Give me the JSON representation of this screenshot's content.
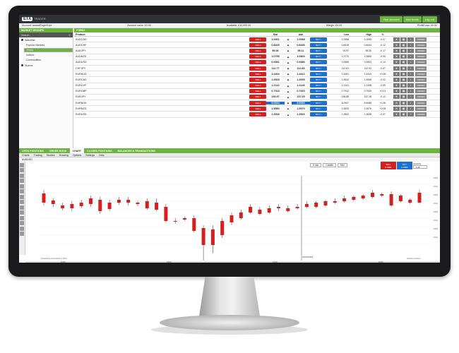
{
  "header": {
    "logo_text": "ETX",
    "logo_sub": "TRADER",
    "buttons": [
      "Your account",
      "Add funds",
      "Log out"
    ]
  },
  "account_bar": {
    "account": "Account: aaaaaRogerGold",
    "account_value": "Account value: £0.00",
    "available": "Available: £10,000.00",
    "margin": "Margin: £0.00",
    "profit_loss": "Profit/Loss: £0.00"
  },
  "market_groups": {
    "title": "MARKET GROUPS",
    "search_placeholder": "Search...",
    "items": [
      {
        "label": "Watchlist",
        "level": 0
      },
      {
        "label": "Popular Markets",
        "level": 1
      },
      {
        "label": "Forex",
        "level": 1,
        "selected": true
      },
      {
        "label": "Indices",
        "level": 1
      },
      {
        "label": "Commodities",
        "level": 1
      },
      {
        "label": "Shares",
        "level": 0
      }
    ]
  },
  "forex": {
    "title": "FOREX",
    "columns": {
      "product": "Product",
      "bid": "Bid",
      "ask": "Ask",
      "low": "Low",
      "high": "High",
      "pct": "%"
    },
    "sell_label": "SELL",
    "buy_label": "BUY",
    "order_label": "ORDER",
    "rows": [
      {
        "product": "AUDCAD",
        "bid": "1.0061",
        "ask": "1.0088",
        "low": "1.0088",
        "high": "1.0096",
        "pct": "-0.07"
      },
      {
        "product": "AUDCHF",
        "bid": "0.8425",
        "ask": "0.8436",
        "low": "0.8415",
        "high": "0.8444",
        "pct": "-0.12"
      },
      {
        "product": "AUDJPY",
        "bid": "95.06",
        "ask": "95.11",
        "low": "94.97",
        "high": "95.30",
        "pct": "-0.17"
      },
      {
        "product": "AUDNZD",
        "bid": "1.0795",
        "ask": "1.0803",
        "low": "1.0770",
        "high": "1.0808",
        "pct": "-0.05"
      },
      {
        "product": "AUDUSD",
        "bid": "0.9381",
        "ask": "0.9386",
        "low": "0.9369",
        "high": "0.9403",
        "pct": "-0.14"
      },
      {
        "product": "CHFJPY",
        "bid": "112.77",
        "ask": "112.83",
        "low": "112.61",
        "high": "112.92",
        "pct": "-0.07"
      },
      {
        "product": "EURAUD",
        "bid": "1.4404",
        "ask": "1.4412",
        "low": "1.4391",
        "high": "1.4443",
        "pct": "+0.06"
      },
      {
        "product": "EURCAD",
        "bid": "1.4525",
        "ask": "1.4535",
        "low": "1.4510",
        "high": "1.4546",
        "pct": "-0.02"
      },
      {
        "product": "EURCHF",
        "bid": "1.2142",
        "ask": "1.2146",
        "low": "1.2141",
        "high": "1.2158",
        "pct": "-0.05"
      },
      {
        "product": "EURGBP",
        "bid": "0.7918",
        "ask": "0.7920",
        "low": "0.7912",
        "high": "0.7926",
        "pct": "+0.01"
      },
      {
        "product": "EURJPY",
        "bid": "136.97",
        "ask": "137.00",
        "low": "136.88",
        "high": "137.18",
        "pct": "-0.12"
      },
      {
        "product": "EURNOK",
        "bid": "8.0034",
        "ask": "8.0084",
        "low": "8.0007",
        "high": "8.4088",
        "pct": "+0.30",
        "highlight": true
      },
      {
        "product": "EURNZD",
        "bid": "1.5550",
        "ask": "1.5570",
        "low": "1.5520",
        "high": "1.5576",
        "pct": "+0.05"
      },
      {
        "product": "EURUSD",
        "bid": "1.3518",
        "ask": "1.3520",
        "low": "1.3502",
        "high": "1.3538",
        "pct": "-0.07"
      }
    ]
  },
  "tabs": [
    "OPEN POSITIONS",
    "ORDER BOOK",
    "CHART",
    "CLOSED POSITIONS",
    "BALANCES & TRANSACTIONS"
  ],
  "active_tab": "CHART",
  "chart_menu": [
    "Charts",
    "Trading",
    "Studies",
    "Drawing",
    "Options",
    "Settings",
    "Help"
  ],
  "chart_panel": {
    "symbol": "AUDUSD",
    "interval": "5 min",
    "style": "Candle",
    "price_mode": "Mid",
    "quick_sell": "SELL",
    "quick_buy": "BUY",
    "quick_sell_price": "0.9381",
    "quick_buy_price": "0.9386",
    "quantity_label": "Quantity",
    "quantity": "1.00",
    "crosshair_date": "21/07/2014",
    "footer_left": "Powered by Amit Charts © 2014",
    "footer_right": "Indicator window",
    "time_labels": [
      "12:00",
      "13:00",
      "14:00",
      "15:00"
    ]
  },
  "colors": {
    "green": "#6cb33f",
    "sell": "#d62020",
    "buy": "#1f6fd1",
    "bezel": "#1a1a1c"
  }
}
